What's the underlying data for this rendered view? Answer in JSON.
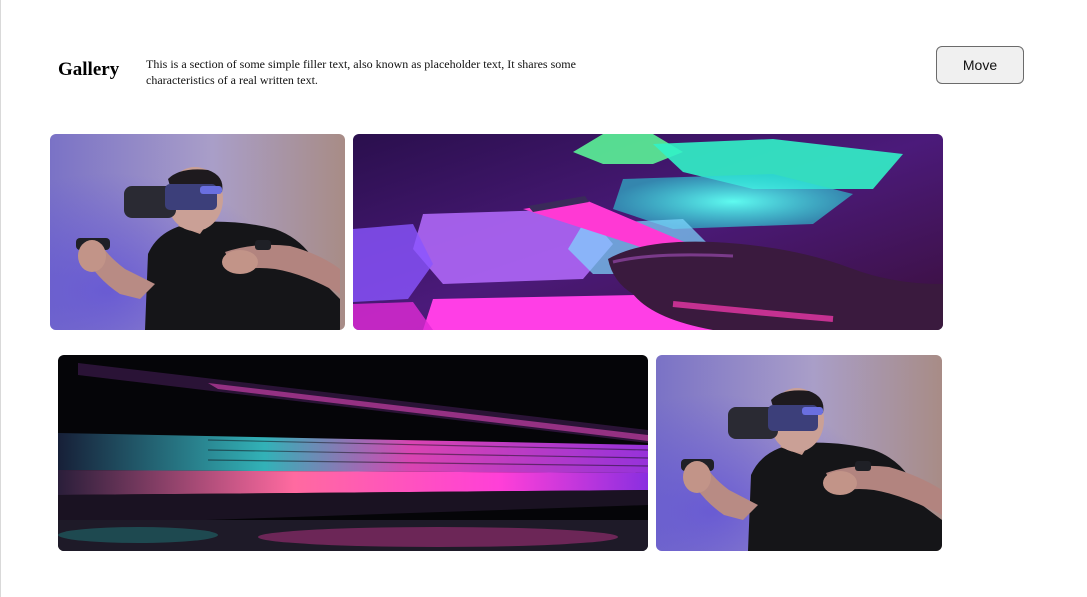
{
  "header": {
    "title": "Gallery",
    "description": "This is a section of some simple filler text, also known as placeholder text, It shares some characteristics of a real written text.",
    "move_label": "Move"
  },
  "gallery": {
    "images": [
      {
        "subject": "man-vr-headset-photo"
      },
      {
        "subject": "hand-neon-hexagon-lights-photo"
      },
      {
        "subject": "laptop-neon-keyboard-photo"
      },
      {
        "subject": "man-vr-headset-photo"
      }
    ]
  },
  "colors": {
    "background": "#ffffff",
    "button_bg": "#f0f0f0",
    "button_border": "#6b6b6b",
    "neon_pink": "#ff2fd6",
    "neon_cyan": "#2ff5e6",
    "neon_purple": "#7a3cff"
  }
}
